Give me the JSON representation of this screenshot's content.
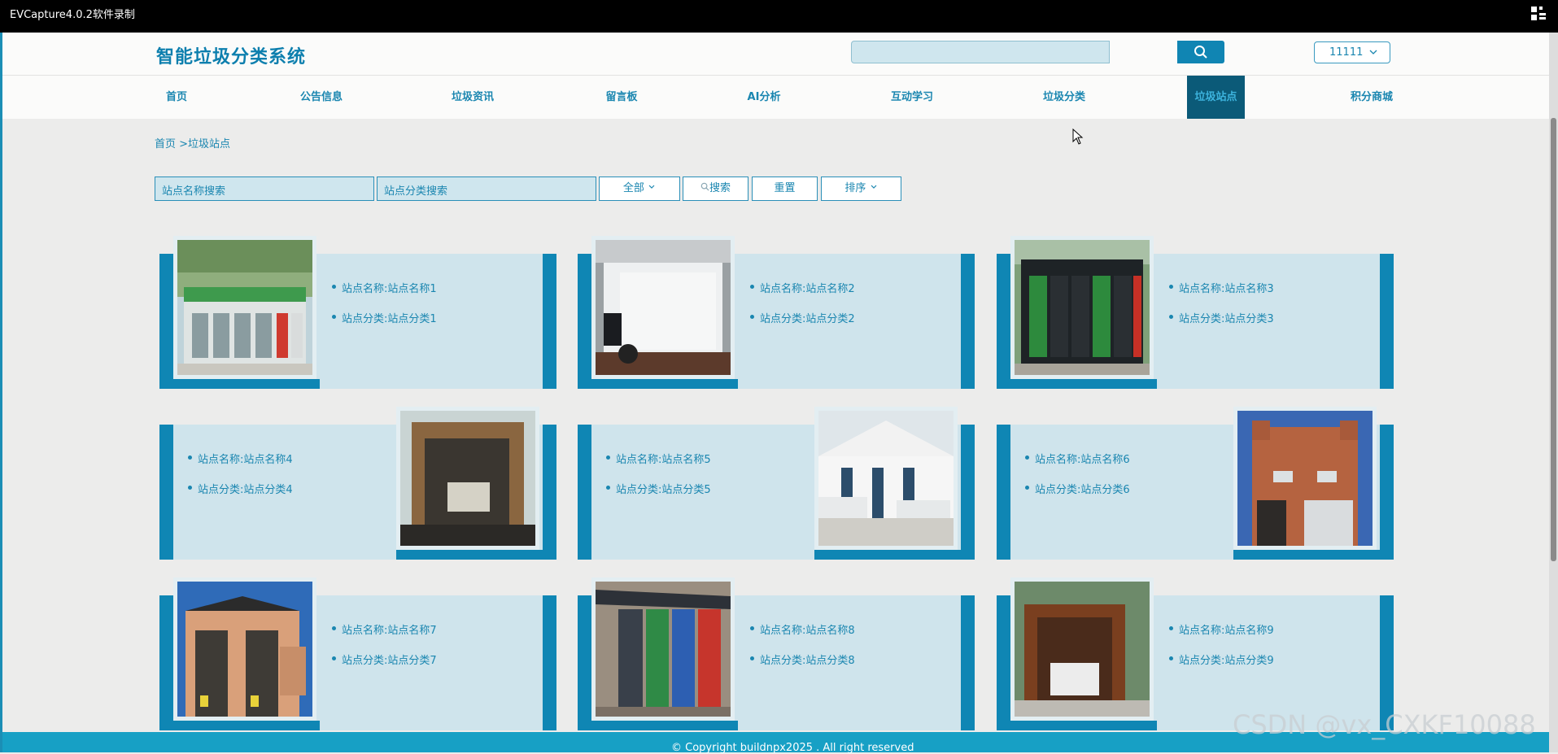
{
  "window": {
    "title": "EVCapture4.0.2软件录制"
  },
  "header": {
    "logo": "智能垃圾分类系统",
    "search_value": "",
    "user": "11111"
  },
  "nav": [
    "首页",
    "公告信息",
    "垃圾资讯",
    "留言板",
    "AI分析",
    "互动学习",
    "垃圾分类",
    "垃圾站点",
    "积分商城"
  ],
  "nav_active": "垃圾站点",
  "breadcrumb": "首页 >垃圾站点",
  "filters": {
    "name_placeholder": "站点名称搜索",
    "category_placeholder": "站点分类搜索",
    "select_value": "全部",
    "search_label": "搜索",
    "reset_label": "重置",
    "sort_label": "排序"
  },
  "cards": [
    {
      "name": "站点名称:站点名称1",
      "category": "站点分类:站点分类1",
      "image": "smart-recycling-station-photo"
    },
    {
      "name": "站点名称:站点名称2",
      "category": "站点分类:站点分类2",
      "image": "garbage-truck-photo"
    },
    {
      "name": "站点名称:站点名称3",
      "category": "站点分类:站点分类3",
      "image": "sorting-kiosk-photo"
    },
    {
      "name": "站点名称:站点名称4",
      "category": "站点分类:站点分类4",
      "image": "transfer-shelter-photo"
    },
    {
      "name": "站点名称:站点名称5",
      "category": "站点分类:站点分类5",
      "image": "transfer-station-building-photo"
    },
    {
      "name": "站点名称:站点名称6",
      "category": "站点分类:站点分类6",
      "image": "brick-station-building-photo"
    },
    {
      "name": "站点名称:站点名称7",
      "category": "站点分类:站点分类7",
      "image": "twin-booth-building-photo"
    },
    {
      "name": "站点名称:站点名称8",
      "category": "站点分类:站点分类8",
      "image": "four-bin-kiosk-photo"
    },
    {
      "name": "站点名称:站点名称9",
      "category": "站点分类:站点分类9",
      "image": "wooden-shelter-photo"
    }
  ],
  "footer": "© Copyright buildnpx2025 . All right reserved",
  "watermark": "CSDN @vx_CXKF10088"
}
